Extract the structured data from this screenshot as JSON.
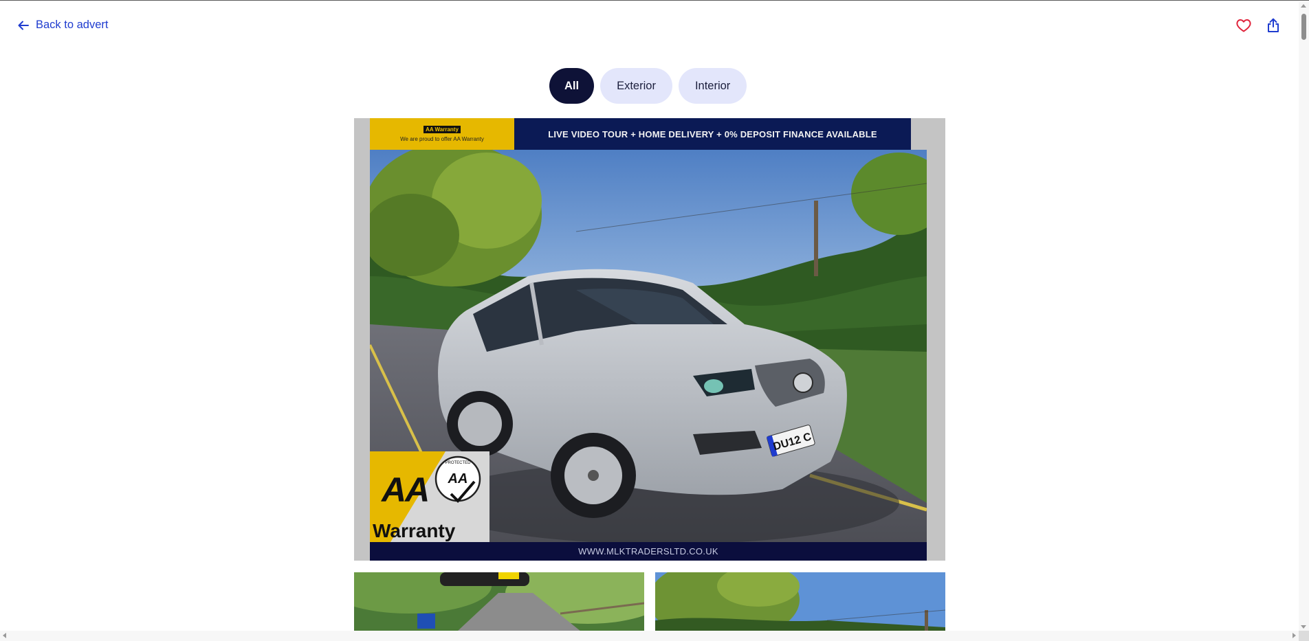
{
  "header": {
    "back_label": "Back to advert",
    "icons": [
      "arrow-left-icon",
      "heart-icon",
      "share-icon"
    ]
  },
  "gallery_tabs": [
    {
      "label": "All",
      "active": true
    },
    {
      "label": "Exterior",
      "active": false
    },
    {
      "label": "Interior",
      "active": false
    }
  ],
  "main_image": {
    "banner_text": "LIVE VIDEO TOUR + HOME DELIVERY + 0% DEPOSIT FINANCE AVAILABLE",
    "aa_top_logo": "AA Warranty",
    "aa_top_caption": "We are proud to offer AA Warranty",
    "aa_badge_letters": "AA",
    "aa_badge_word": "Warranty",
    "aa_badge_seal": "PROTECTED",
    "plate_text": "DU12 C",
    "website": "WWW.MLKTRADERSLTD.CO.UK"
  },
  "colors": {
    "link": "#1f3ccf",
    "heart": "#e0233b",
    "tab_active_bg": "#0e1237",
    "tab_bg": "#e3e6fb",
    "banner_bg": "#0b1a55",
    "aa_yellow": "#e6b800"
  }
}
